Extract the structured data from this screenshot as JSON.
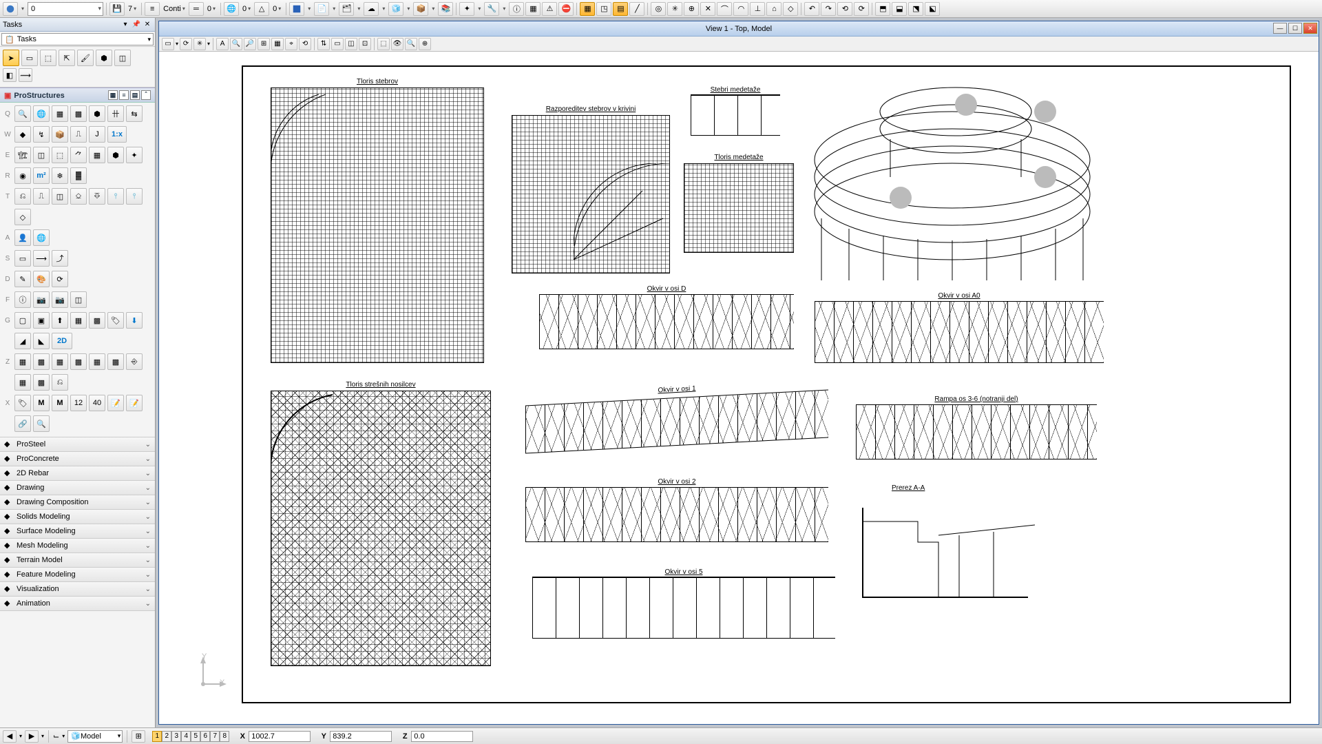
{
  "app": {
    "view_title": "View 1 - Top, Model",
    "tasks_panel_title": "Tasks",
    "tasks_dropdown": "Tasks",
    "pro_structures_heading": "ProStructures"
  },
  "top_toolbar": {
    "value_combo": "0",
    "label_conti": "Conti",
    "zero_labels": [
      "7",
      "0",
      "0",
      "0"
    ],
    "scale_label": "1:x"
  },
  "collapsibles": [
    {
      "icon": "steel",
      "label": "ProSteel"
    },
    {
      "icon": "concrete",
      "label": "ProConcrete"
    },
    {
      "icon": "rebar",
      "label": "2D Rebar"
    },
    {
      "icon": "drawing",
      "label": "Drawing"
    },
    {
      "icon": "dcomp",
      "label": "Drawing Composition"
    },
    {
      "icon": "solids",
      "label": "Solids Modeling"
    },
    {
      "icon": "surface",
      "label": "Surface Modeling"
    },
    {
      "icon": "mesh",
      "label": "Mesh Modeling"
    },
    {
      "icon": "terrain",
      "label": "Terrain Model"
    },
    {
      "icon": "feature",
      "label": "Feature Modeling"
    },
    {
      "icon": "viz",
      "label": "Visualization"
    },
    {
      "icon": "anim",
      "label": "Animation"
    }
  ],
  "drawings": {
    "d1": "Tloris stebrov",
    "d2": "Razporeditev stebrov v krivini",
    "d3": "Stebri medetaže",
    "d4": "Tloris medetaže",
    "d5": "Okvir v osi D",
    "d6": "Tloris strešnih nosilcev",
    "d7": "Okvir v osi A0",
    "d8": "Okvir v osi 1",
    "d9": "Rampa os 3-6 (notranji del)",
    "d10": "Okvir v osi 2",
    "d11": "Prerez A-A",
    "d12": "Okvir v osi 5"
  },
  "status": {
    "model_combo": "Model",
    "X": "1002.7",
    "Y": "839.2",
    "Z": "0.0",
    "axis_y": "Y",
    "axis_x": "X"
  },
  "view_numbers": [
    "1",
    "2",
    "3",
    "4",
    "5",
    "6",
    "7",
    "8"
  ],
  "tool_row_leads": [
    "Q",
    "W",
    "E",
    "R",
    "T",
    "",
    "A",
    "S",
    "D",
    "F",
    "G",
    "",
    "Z",
    "X"
  ],
  "twod_label": "2D",
  "m2_label": "m²"
}
